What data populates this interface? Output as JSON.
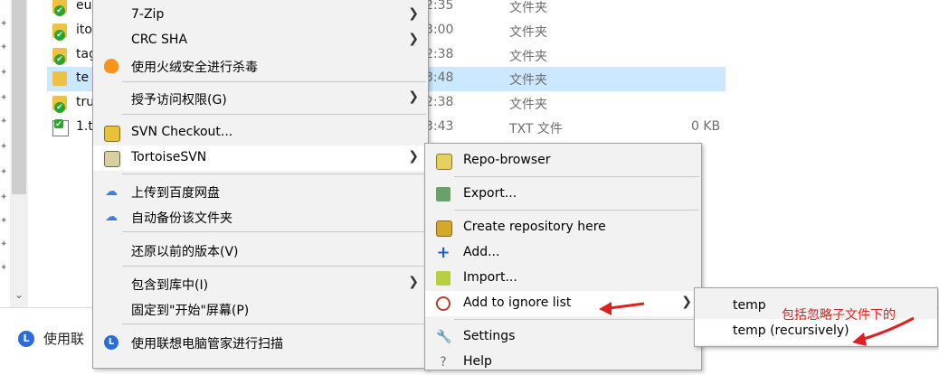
{
  "explorer": {
    "files": [
      {
        "name": "eu",
        "time": "2:35",
        "type": "文件夹",
        "size": ""
      },
      {
        "name": "ito",
        "time": "3:00",
        "type": "文件夹",
        "size": ""
      },
      {
        "name": "tag",
        "time": "2:38",
        "type": "文件夹",
        "size": ""
      },
      {
        "name": "te",
        "time": "3:48",
        "type": "文件夹",
        "size": ""
      },
      {
        "name": "tru",
        "time": "2:38",
        "type": "文件夹",
        "size": ""
      },
      {
        "name": "1.t",
        "time": "3:43",
        "type": "TXT 文件",
        "size": "0 KB"
      }
    ],
    "bottom_item": "使用联"
  },
  "main_menu": {
    "items": [
      {
        "label": "7-Zip"
      },
      {
        "label": "CRC SHA"
      },
      {
        "label": "使用火绒安全进行杀毒"
      },
      {
        "label": "授予访问权限(G)"
      },
      {
        "label": "SVN Checkout..."
      },
      {
        "label": "TortoiseSVN"
      },
      {
        "label": "上传到百度网盘"
      },
      {
        "label": "自动备份该文件夹"
      },
      {
        "label": "还原以前的版本(V)"
      },
      {
        "label": "包含到库中(I)"
      },
      {
        "label": "固定到\"开始\"屏幕(P)"
      },
      {
        "label": "使用联想电脑管家进行扫描"
      }
    ]
  },
  "svn_menu": {
    "items": [
      {
        "label": "Repo-browser"
      },
      {
        "label": "Export..."
      },
      {
        "label": "Create repository here"
      },
      {
        "label": "Add..."
      },
      {
        "label": "Import..."
      },
      {
        "label": "Add to ignore list"
      },
      {
        "label": "Settings"
      },
      {
        "label": "Help"
      }
    ]
  },
  "ignore_menu": {
    "items": [
      {
        "label": "temp"
      },
      {
        "label": "temp (recursively)"
      }
    ]
  },
  "annotation": {
    "text": "包括忽略子文件下的",
    "color": "#e02020"
  },
  "icons": {
    "checkmark": "✔",
    "arrow": "❯",
    "plus": "+",
    "wrench": "🔧",
    "cloud": "☁",
    "lenovo": "L"
  }
}
